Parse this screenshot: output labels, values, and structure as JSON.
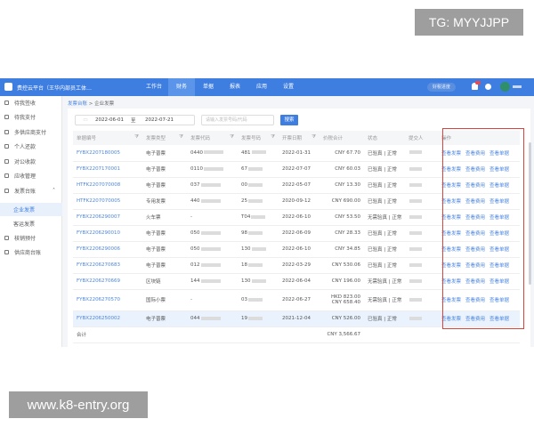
{
  "watermark_top": "TG: MYYJJPP",
  "watermark_bottom": "www.k8-entry.org",
  "app": {
    "title": "费控云平台（王华内部员工体…",
    "nav": [
      "工作台",
      "财务",
      "单据",
      "报表",
      "应用",
      "设置"
    ],
    "active_nav": "财务",
    "progress_btn": "好税进度",
    "notification_count": "99+"
  },
  "sidebar": [
    {
      "label": "待我签收"
    },
    {
      "label": "待我支付"
    },
    {
      "label": "多供应商支付"
    },
    {
      "label": "个人还款"
    },
    {
      "label": "对公收款"
    },
    {
      "label": "应收管理"
    },
    {
      "label": "发票台账"
    },
    {
      "label": "企业发票",
      "selected": true
    },
    {
      "label": "客运发票"
    },
    {
      "label": "核销预付"
    },
    {
      "label": "供应商台账"
    }
  ],
  "breadcrumb": {
    "parent": "发票台账",
    "current": "企业发票"
  },
  "filter": {
    "start": "2022-06-01",
    "sep": "至",
    "end": "2022-07-21",
    "search_placeholder": "请输入发票号码/代码",
    "search_btn": "搜索"
  },
  "table": {
    "headers": [
      "单据编号",
      "发票类型",
      "发票代码",
      "发票号码",
      "开票日期",
      "价税合计",
      "状态",
      "提交人",
      "操作"
    ],
    "ops": [
      "查看发票",
      "查看费用",
      "查看单据"
    ],
    "rows": [
      {
        "no": "FYBX2207180005",
        "type": "电子普票",
        "code": "0440",
        "num": "481",
        "date": "2022-01-31",
        "amount": "CNY 67.70",
        "status": "已验真 | 正常"
      },
      {
        "no": "FYBX2207170001",
        "type": "电子普票",
        "code": "0110",
        "num": "67",
        "date": "2022-07-07",
        "amount": "CNY 60.03",
        "status": "已验真 | 正常"
      },
      {
        "no": "HTFK2207070008",
        "type": "电子普票",
        "code": "037",
        "num": "00",
        "date": "2022-05-07",
        "amount": "CNY 13.30",
        "status": "已验真 | 正常"
      },
      {
        "no": "HTFK2207070005",
        "type": "专用发票",
        "code": "440",
        "num": "25",
        "date": "2020-09-12",
        "amount": "CNY 690.00",
        "status": "已验真 | 正常"
      },
      {
        "no": "FYBX2206290007",
        "type": "火车票",
        "code": "-",
        "num": "T04",
        "date": "2022-06-10",
        "amount": "CNY 53.50",
        "status": "无需验真 | 正常"
      },
      {
        "no": "FYBX2206290010",
        "type": "电子普票",
        "code": "050",
        "num": "98",
        "date": "2022-06-09",
        "amount": "CNY 28.33",
        "status": "已验真 | 正常"
      },
      {
        "no": "FYBX2206290006",
        "type": "电子普票",
        "code": "050",
        "num": "130",
        "date": "2022-06-10",
        "amount": "CNY 34.85",
        "status": "已验真 | 正常"
      },
      {
        "no": "FYBX2206270683",
        "type": "电子普票",
        "code": "012",
        "num": "18",
        "date": "2022-03-29",
        "amount": "CNY 530.06",
        "status": "已验真 | 正常"
      },
      {
        "no": "FYBX2206270669",
        "type": "区块链",
        "code": "144",
        "num": "130",
        "date": "2022-06-04",
        "amount": "CNY 196.00",
        "status": "无需验真 | 正常"
      },
      {
        "no": "FYBX2206270570",
        "type": "国际小票",
        "code": "-",
        "num": "03",
        "date": "2022-06-27",
        "amount": "HKD 823.00",
        "amount2": "CNY 658.40",
        "status": "无需验真 | 正常"
      },
      {
        "no": "FYBX2206250002",
        "type": "电子普票",
        "code": "044",
        "num": "19",
        "date": "2021-12-04",
        "amount": "CNY 526.00",
        "status": "已验真 | 正常"
      }
    ],
    "total_label": "合计",
    "total": "CNY 3,566.67"
  }
}
